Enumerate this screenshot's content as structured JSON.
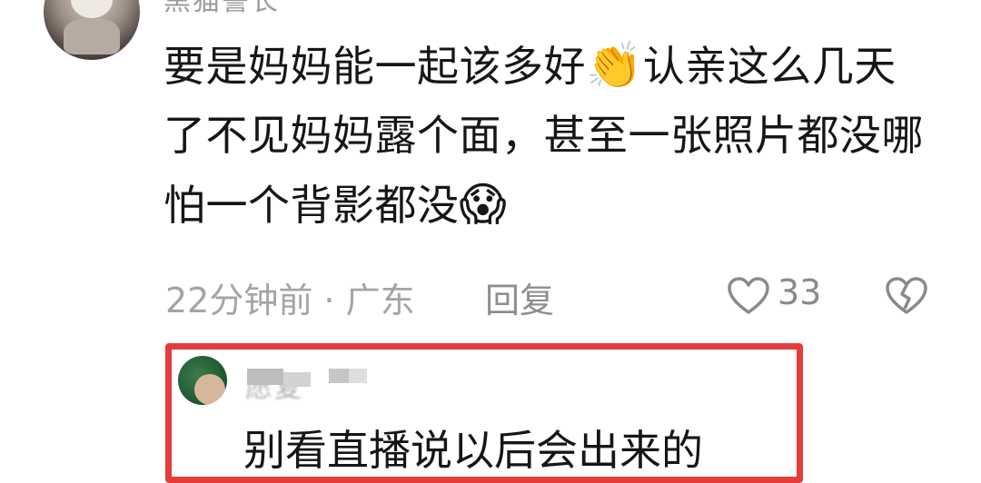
{
  "comment": {
    "username": "黑猫警长",
    "text_part1": "要是妈妈能一起该多好",
    "emoji_clap": "👏",
    "text_part2": "认亲这么几天了不见妈妈露个面，甚至一张照片都没哪怕一个背影都没",
    "emoji_scream": "😱",
    "time_location": "22分钟前 · 广东",
    "reply_label": "回复",
    "like_count": "33"
  },
  "reply": {
    "username": "愿复",
    "text": "别看直播说以后会出来的"
  },
  "icons": {
    "like": "heart-outline-icon",
    "dislike": "broken-heart-icon"
  },
  "colors": {
    "highlight": "#e53b3b",
    "text": "#161616",
    "meta": "#a4a4a4"
  }
}
